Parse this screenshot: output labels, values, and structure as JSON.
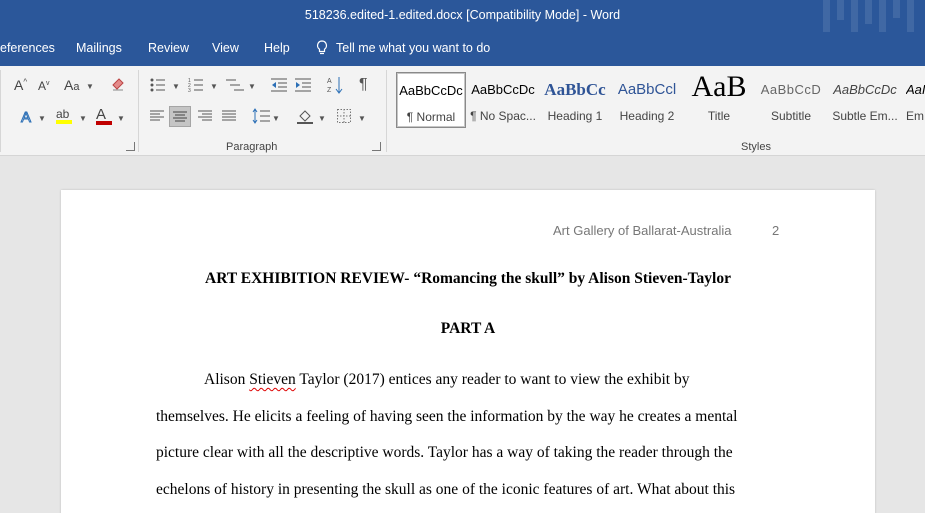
{
  "window": {
    "title": "518236.edited-1.edited.docx [Compatibility Mode]  -  Word"
  },
  "tabs": [
    {
      "label": "eferences"
    },
    {
      "label": "Mailings"
    },
    {
      "label": "Review"
    },
    {
      "label": "View"
    },
    {
      "label": "Help"
    }
  ],
  "tell_me": "Tell me what you want to do",
  "font_group": {
    "grow": "A",
    "shrink": "A",
    "sort_label": "A",
    "highlight_label": "ab",
    "font_color_label": "A"
  },
  "paragraph_group": {
    "label": "Paragraph",
    "pilcrow": "¶"
  },
  "styles_group": {
    "label": "Styles",
    "items": [
      {
        "preview": "AaBbCcDc",
        "name": "¶ Normal"
      },
      {
        "preview": "AaBbCcDc",
        "name": "¶ No Spac..."
      },
      {
        "preview": "AaBbCc",
        "name": "Heading 1"
      },
      {
        "preview": "AaBbCcl",
        "name": "Heading 2"
      },
      {
        "preview": "AaB",
        "name": "Title"
      },
      {
        "preview": "AaBbCcD",
        "name": "Subtitle"
      },
      {
        "preview": "AaBbCcDc",
        "name": "Subtle Em..."
      },
      {
        "preview": "AaI",
        "name": "Em"
      }
    ]
  },
  "document": {
    "header_text": "Art Gallery of Ballarat-Australia",
    "page_number": "2",
    "title": "ART EXHIBITION REVIEW- “Romancing the skull” by Alison Stieven-Taylor",
    "part": "PART A",
    "line1_a": "Alison ",
    "line1_b": "Stieven",
    "line1_c": " Taylor (2017) entices any reader to want to view the exhibit by",
    "line2": "themselves. He elicits a feeling of having seen the information by the way he creates a mental",
    "line3": "picture clear with all the descriptive words. Taylor has a way of taking the reader through the",
    "line4": "echelons of history in presenting the skull as one of the iconic features of art. What about this"
  },
  "colors": {
    "brand": "#2b579a",
    "highlight": "#ffff00",
    "font_color": "#c00000"
  }
}
